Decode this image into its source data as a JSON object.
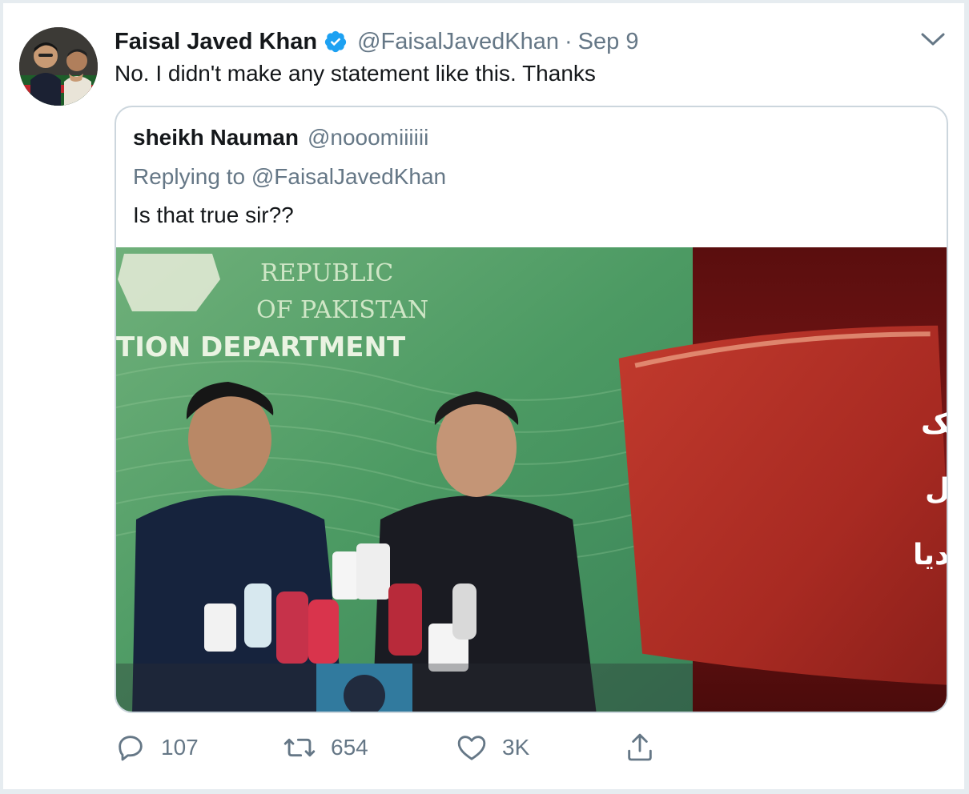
{
  "tweet": {
    "author_name": "Faisal Javed Khan",
    "author_handle": "@FaisalJavedKhan",
    "separator": "·",
    "date": "Sep 9",
    "text": "No. I didn't make any statement like this. Thanks",
    "verified": true
  },
  "quoted_tweet": {
    "author_name": "sheikh Nauman",
    "author_handle": "@nooomiiiiii",
    "replying_to": "Replying to @FaisalJavedKhan",
    "text": "Is that true sir??",
    "image": {
      "backdrop_text_line1": "REPUBLIC",
      "backdrop_text_line2": "OF PAKISTAN",
      "backdrop_text_line3": "TION DEPARTMENT",
      "urdu_line1": "امریکا میں مقیم پاکستانی ایک",
      "urdu_line2": "ارب ڈالر دینا چاہتا ہے، فیصل",
      "urdu_line3": "جاوید نے وزیراعظم کو بتادیا"
    }
  },
  "actions": {
    "reply_count": "107",
    "retweet_count": "654",
    "like_count": "3K"
  },
  "colors": {
    "text_primary": "#14171a",
    "text_secondary": "#657786",
    "verified_blue": "#1da1f2",
    "border": "#ccd6dd"
  },
  "icons": {
    "caret": "chevron-down-icon",
    "reply": "reply-icon",
    "retweet": "retweet-icon",
    "like": "heart-icon",
    "share": "share-icon",
    "verified": "verified-badge-icon"
  }
}
